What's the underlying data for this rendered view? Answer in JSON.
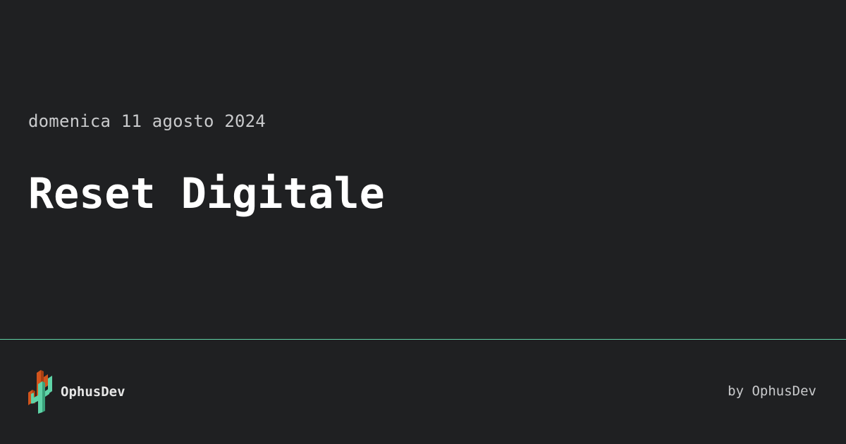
{
  "post": {
    "date": "domenica 11 agosto 2024",
    "title": "Reset Digitale"
  },
  "footer": {
    "brand_name": "OphusDev",
    "byline": "by OphusDev"
  },
  "icons": {
    "logo": "cactus-logo-icon"
  },
  "colors": {
    "background": "#1f2022",
    "accent": "#5fd3a7",
    "logo_orange": "#d2541c",
    "logo_green": "#5fd3a7"
  }
}
